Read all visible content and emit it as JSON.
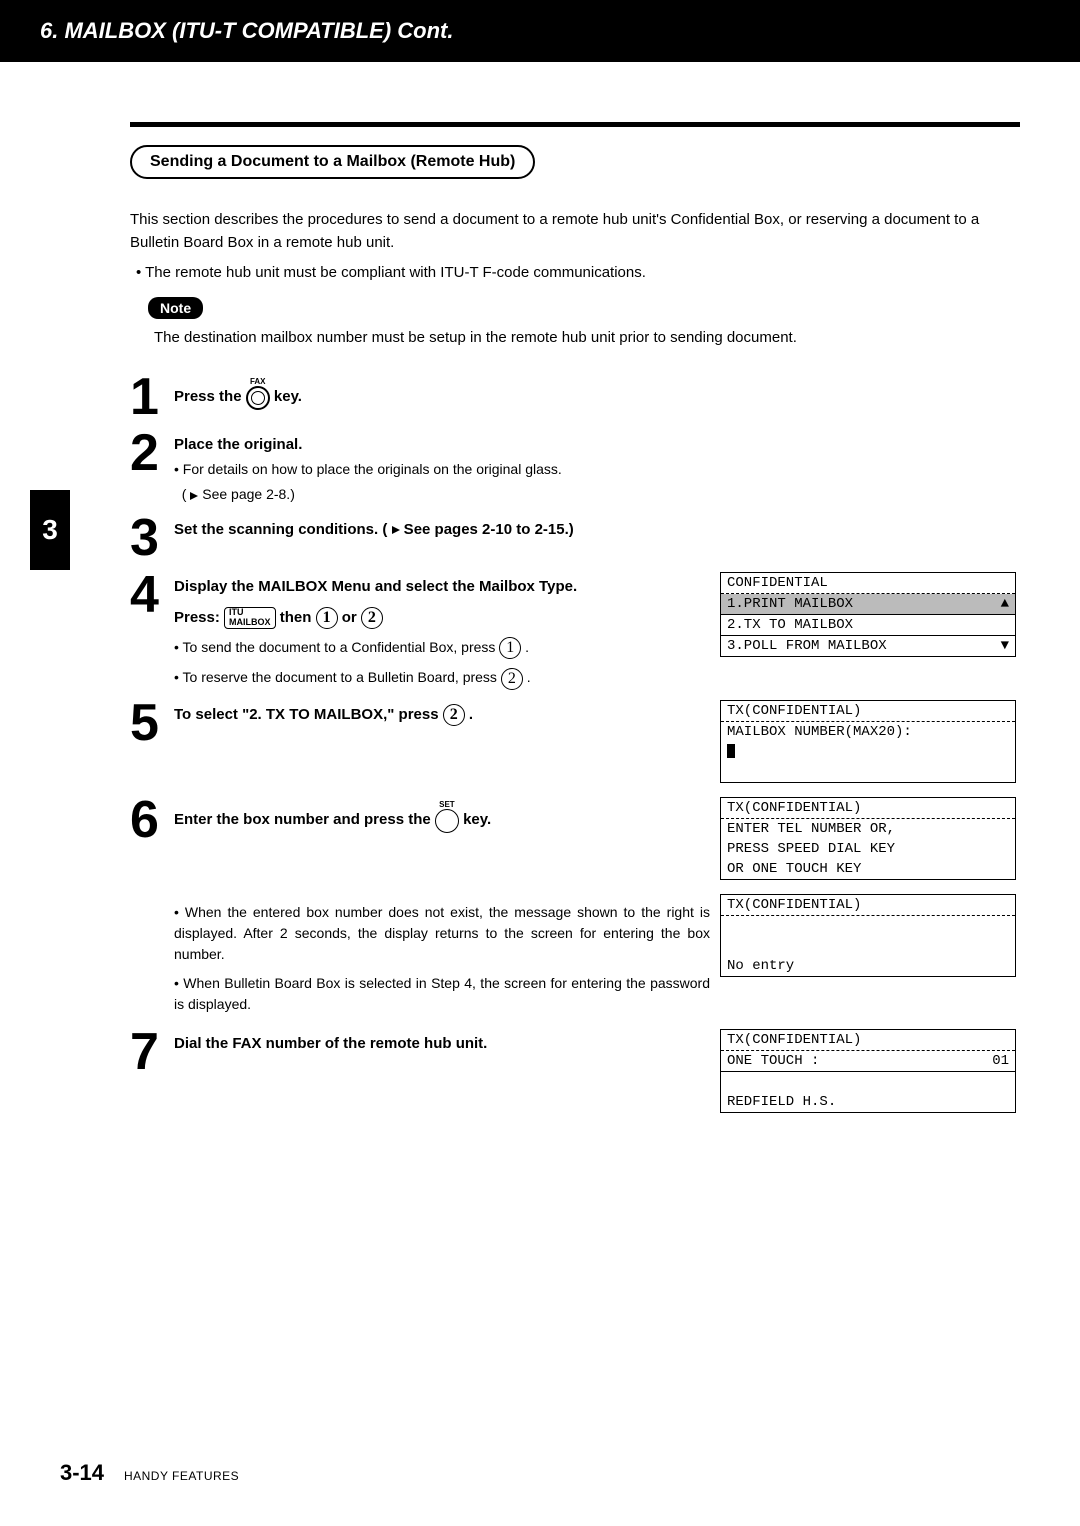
{
  "header": "6. MAILBOX (ITU-T COMPATIBLE) Cont.",
  "side_tab": "3",
  "section_title": "Sending a Document to a Mailbox (Remote Hub)",
  "intro": "This section describes the procedures to send a document to a remote hub unit's Confidential Box, or reserving a document to a Bulletin Board Box in a remote hub unit.",
  "intro_bullet": "• The remote hub unit must be compliant with ITU-T F-code communications.",
  "note_label": "Note",
  "note_text": "The destination mailbox number must be setup in the remote hub unit prior to sending document.",
  "steps": {
    "s1": {
      "num": "1",
      "title_a": "Press the ",
      "title_b": " key.",
      "fax_label": "FAX"
    },
    "s2": {
      "num": "2",
      "title": "Place the original.",
      "sub": "• For details on how to place the originals on the original glass.",
      "sub2_a": "( ",
      "sub2_b": " See page 2-8.)"
    },
    "s3": {
      "num": "3",
      "title_a": "Set the scanning conditions. ( ",
      "title_b": " See pages 2-10 to 2-15.)"
    },
    "s4": {
      "num": "4",
      "title": "Display the MAILBOX Menu and select the Mailbox Type.",
      "press_a": "Press: ",
      "keycap_top": "ITU",
      "keycap_bot": "MAILBOX",
      "press_b": " then ",
      "press_c": " or ",
      "b1_a": "• To send the document to a Confidential Box, press ",
      "b1_b": " .",
      "b2_a": "• To reserve the document to a Bulletin Board, press ",
      "b2_b": " ."
    },
    "s5": {
      "num": "5",
      "title_a": "To select \"2. TX TO MAILBOX,\" press ",
      "title_b": " ."
    },
    "s6": {
      "num": "6",
      "title_a": "Enter the box number and press the ",
      "title_b": " key.",
      "set_label": "SET",
      "b1": "• When the entered box number does not exist, the message shown to the right is displayed. After 2 seconds, the display returns to the screen for entering the box number.",
      "b2": "• When Bulletin Board Box is selected in Step 4, the screen for entering the password is displayed."
    },
    "s7": {
      "num": "7",
      "title": "Dial the FAX number of the remote hub unit."
    }
  },
  "lcd": {
    "d4": {
      "l1": "CONFIDENTIAL",
      "l2": "1.PRINT MAILBOX",
      "l3": "2.TX TO MAILBOX",
      "l4": "3.POLL FROM MAILBOX",
      "up": "▲",
      "dn": "▼"
    },
    "d5": {
      "l1": "TX(CONFIDENTIAL)",
      "l2": "MAILBOX NUMBER(MAX20):"
    },
    "d6": {
      "l1": "TX(CONFIDENTIAL)",
      "l2": "ENTER TEL NUMBER OR,",
      "l3": "PRESS SPEED DIAL KEY",
      "l4": "OR ONE TOUCH KEY"
    },
    "d6b": {
      "l1": "TX(CONFIDENTIAL)",
      "l4": "No entry"
    },
    "d7": {
      "l1": "TX(CONFIDENTIAL)",
      "l2a": "ONE TOUCH :",
      "l2b": "01",
      "l4": "REDFIELD H.S."
    }
  },
  "key_digits": {
    "one": "1",
    "two": "2"
  },
  "footer": {
    "page": "3-14",
    "section": "HANDY FEATURES"
  }
}
